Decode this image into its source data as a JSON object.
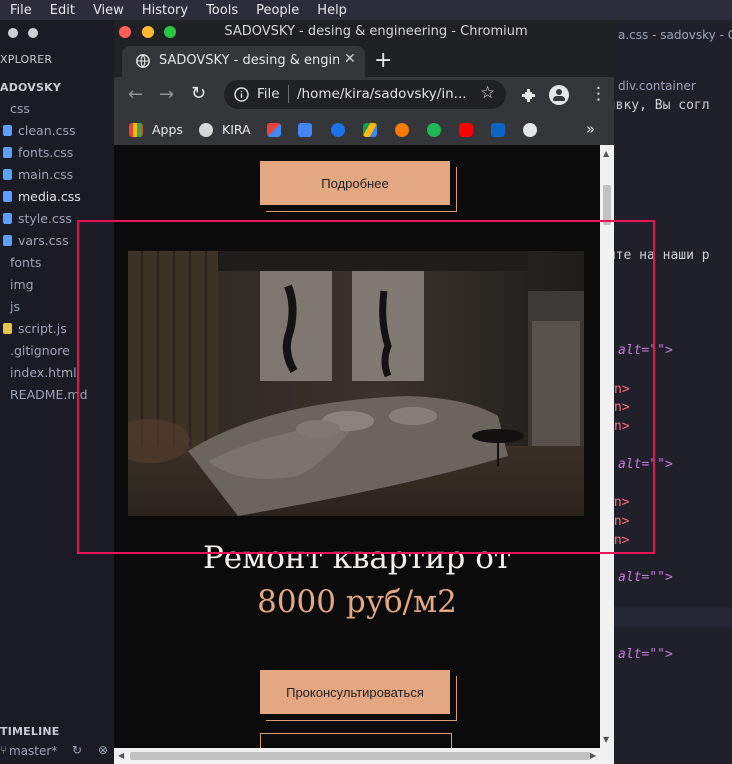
{
  "os_menu": [
    "File",
    "Edit",
    "View",
    "History",
    "Tools",
    "People",
    "Help"
  ],
  "sidebar": {
    "explorer_label": "XPLORER",
    "project_label": "ADOVSKY",
    "items": [
      {
        "label": "css",
        "color": ""
      },
      {
        "label": "clean.css",
        "color": "#5aa0ff"
      },
      {
        "label": "fonts.css",
        "color": "#5aa0ff"
      },
      {
        "label": "main.css",
        "color": "#5aa0ff"
      },
      {
        "label": "media.css",
        "color": "#5aa0ff"
      },
      {
        "label": "style.css",
        "color": "#5aa0ff"
      },
      {
        "label": "vars.css",
        "color": "#5aa0ff"
      },
      {
        "label": "fonts",
        "color": ""
      },
      {
        "label": "img",
        "color": ""
      },
      {
        "label": "js",
        "color": ""
      },
      {
        "label": "script.js",
        "color": "#e6c54a"
      },
      {
        "label": ".gitignore",
        "color": ""
      },
      {
        "label": "index.html",
        "color": ""
      },
      {
        "label": "README.md",
        "color": ""
      }
    ],
    "timeline_label": "TIMELINE",
    "branch": "master*"
  },
  "editor": {
    "title_fragment": "a.css - sadovsky - C",
    "breadcrumb": "div.container",
    "lines": [
      {
        "text": "аявку, Вы согл"
      },
      {
        "text": "ните на наши р"
      },
      {
        "text": "alt=\"\">"
      },
      {
        "text": "n>"
      },
      {
        "text": "n>"
      },
      {
        "text": "n>"
      },
      {
        "text": "alt=\"\">"
      },
      {
        "text": "an>"
      },
      {
        "text": "an>"
      },
      {
        "text": "an>"
      },
      {
        "text": "alt=\"\">"
      },
      {
        "text": "alt=\"\">"
      }
    ]
  },
  "browser": {
    "window_title": "SADOVSKY - desing & engineering - Chromium",
    "tab_title": "SADOVSKY - desing & enginee",
    "omnibox_prefix": "File",
    "omnibox_url": "/home/kira/sadovsky/in...",
    "bookmarks": [
      {
        "label": "Apps",
        "icon": "apps-grid-icon"
      },
      {
        "label": "KIRA",
        "icon": "kira-icon"
      },
      {
        "label": "",
        "icon": "gmail-icon"
      },
      {
        "label": "",
        "icon": "translate-icon"
      },
      {
        "label": "",
        "icon": "contacts-icon"
      },
      {
        "label": "",
        "icon": "drive-icon"
      },
      {
        "label": "",
        "icon": "music-icon"
      },
      {
        "label": "",
        "icon": "spotify-icon"
      },
      {
        "label": "",
        "icon": "youtube-icon"
      },
      {
        "label": "",
        "icon": "linkedin-icon"
      },
      {
        "label": "",
        "icon": "github-icon"
      }
    ]
  },
  "page": {
    "btn_more": "Подробнее",
    "heading": "Ремонт квартир от",
    "price": "8000 руб/м2",
    "btn_consult": "Проконсультироваться"
  },
  "colors": {
    "accent": "#e3a882",
    "highlight": "#e8135a"
  }
}
